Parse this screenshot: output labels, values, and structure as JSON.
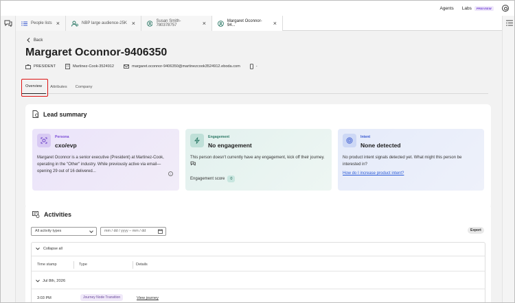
{
  "topbar": {
    "agents": "Agents",
    "labs": "Labs",
    "preview": "PREVIEW"
  },
  "tabs": [
    {
      "label": "People lists",
      "icon": "list-icon"
    },
    {
      "label": "NBP large audience-25K",
      "icon": "audience-icon"
    },
    {
      "label": "Susan Smith-780378757",
      "icon": "person-icon"
    },
    {
      "label": "Margaret Oconnor-94...",
      "icon": "person-icon"
    }
  ],
  "page": {
    "back": "Back",
    "title": "Margaret Oconnor-9406350",
    "meta": {
      "role": "PRESIDENT",
      "company": "Martinez-Cook-3524912",
      "email": "margaret.oconnor-9406350@martinezcook3524912.eboda.com",
      "phone": "-"
    },
    "subtabs": [
      "Overview",
      "Attributes",
      "Company"
    ]
  },
  "lead": {
    "title": "Lead summary",
    "persona": {
      "kicker": "Persona",
      "value": "cxo/evp",
      "desc": "Margaret Oconnor is a senior executive (President) at Martinez-Cook, operating in the \"Other\" industry. While previously active via email—opening 29 out of 16 delivered..."
    },
    "engagement": {
      "kicker": "Engagement",
      "value": "No engagement",
      "desc": "This person doesn't currently have any engagement, kick off their journey.",
      "score_label": "Engagement score",
      "score": "0"
    },
    "intent": {
      "kicker": "Intent",
      "value": "None detected",
      "desc": "No product intent signals detected yet. What might this person be interested in?",
      "link": "How do I increase product intent?"
    }
  },
  "activities": {
    "title": "Activities",
    "filter": "All activity types",
    "date_placeholder": "mm / dd / yyyy – mm / dd",
    "export": "Export",
    "collapse": "Collapse all",
    "headers": [
      "Time stamp",
      "Type",
      "Details"
    ],
    "group": "Jul 8th, 2026",
    "row": {
      "time": "3:03 PM",
      "type": "Journey Node Transition",
      "details": "View journey"
    }
  },
  "colors": {
    "persona": "#7a4bd6",
    "engagement": "#2f7a68",
    "intent": "#3a5ad0",
    "highlight": "#d11111"
  }
}
